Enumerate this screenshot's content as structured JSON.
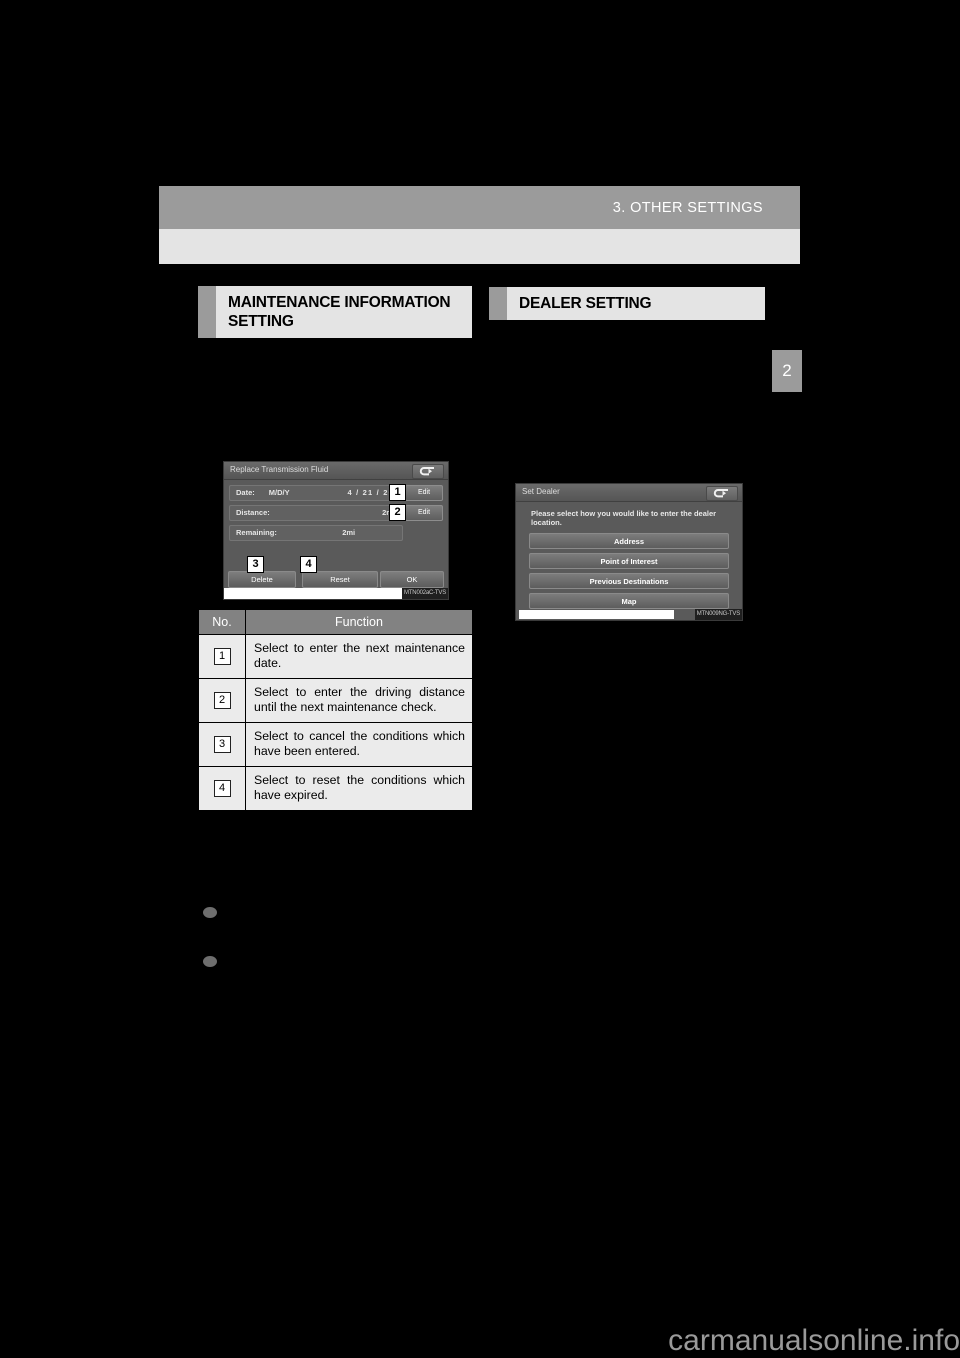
{
  "page": {
    "header_title": "3. OTHER SETTINGS",
    "chapter_tab": "2",
    "watermark": "carmanualsonline.info"
  },
  "sections": {
    "maintenance": {
      "title": "MAINTENANCE INFORMATION SETTING"
    },
    "dealer": {
      "title": "DEALER SETTING"
    }
  },
  "maintenance_screen": {
    "title": "Replace Transmission Fluid",
    "back_icon": "back-arrow-icon",
    "rows": [
      {
        "label": "Date:",
        "format": "M/D/Y",
        "value": "4 /  21 /  20",
        "button": "Edit"
      },
      {
        "label": "Distance:",
        "value": "2mi",
        "button": "Edit"
      },
      {
        "label": "Remaining:",
        "value": "2mi"
      }
    ],
    "buttons": {
      "delete": "Delete",
      "reset": "Reset",
      "ok": "OK"
    },
    "callouts": [
      "1",
      "2",
      "3",
      "4"
    ],
    "code": "MTN002aC-TVS"
  },
  "dealer_screen": {
    "title": "Set Dealer",
    "back_icon": "back-arrow-icon",
    "prompt": "Please select how you would like to enter the dealer location.",
    "options": [
      "Address",
      "Point of Interest",
      "Previous Destinations",
      "Map"
    ],
    "code": "MTN009NG-TVS"
  },
  "function_table": {
    "headers": {
      "no": "No.",
      "function": "Function"
    },
    "rows": [
      {
        "no": "1",
        "text": "Select to enter the next maintenance date."
      },
      {
        "no": "2",
        "text": "Select to enter the driving distance until the next maintenance check."
      },
      {
        "no": "3",
        "text": "Select to cancel the conditions which have been entered."
      },
      {
        "no": "4",
        "text": "Select to reset the conditions which have expired."
      }
    ]
  }
}
